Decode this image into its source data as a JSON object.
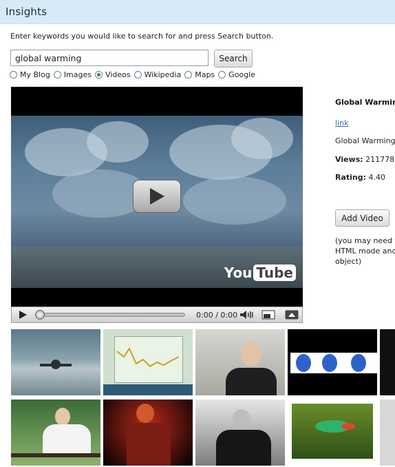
{
  "header": {
    "title": "Insights"
  },
  "instructions": "Enter keywords you would like to search for and press Search button.",
  "search": {
    "value": "global warming",
    "button_label": "Search"
  },
  "sources": {
    "options": [
      "My Blog",
      "Images",
      "Videos",
      "Wikipedia",
      "Maps",
      "Google"
    ],
    "selected": "Videos"
  },
  "player": {
    "time": "0:00 / 0:00",
    "logo_you": "You",
    "logo_tube": "Tube",
    "progress": 0
  },
  "video_info": {
    "title": "Global Warming",
    "link_label": "link",
    "description": "Global Warming",
    "views_label": "Views:",
    "views": "211778",
    "rating_label": "Rating:",
    "rating": "4.40",
    "add_button_label": "Add Video",
    "note_lines": [
      "(you may need to",
      "HTML mode and",
      "object)"
    ]
  },
  "thumbnails": [
    {
      "subject": "airplane"
    },
    {
      "subject": "chart"
    },
    {
      "subject": "presenter"
    },
    {
      "subject": "blue-faces"
    },
    {
      "subject": "man-on-fence"
    },
    {
      "subject": "musician"
    },
    {
      "subject": "speaker"
    },
    {
      "subject": "bird"
    }
  ],
  "colors": {
    "header_bg": "#d6ebf7",
    "link": "#3366aa",
    "radio_selected": "#3a8a3a"
  }
}
